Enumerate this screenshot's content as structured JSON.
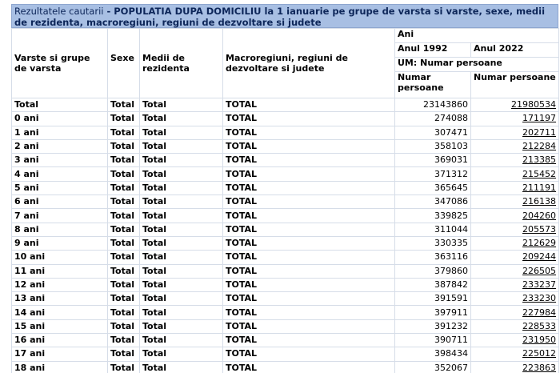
{
  "caption": {
    "lead": "Rezultatele cautarii",
    "rest": " - POPULATIA DUPA DOMICILIU la 1 ianuarie pe grupe de varsta si varste, sexe, medii de rezidenta, macroregiuni, regiuni de dezvoltare si judete"
  },
  "headers": {
    "age": "Varste si grupe de varsta",
    "sex": "Sexe",
    "medium": "Medii de rezidenta",
    "region": "Macroregiuni, regiuni de dezvoltare si judete",
    "ani": "Ani",
    "year1": "Anul 1992",
    "year2": "Anul 2022",
    "um": "UM: Numar persoane",
    "unit1": "Numar persoane",
    "unit2": "Numar persoane"
  },
  "rows": [
    {
      "age": "Total",
      "sex": "Total",
      "medium": "Total",
      "region": "TOTAL",
      "v1992": "23143860",
      "v2022": "21980534"
    },
    {
      "age": "0 ani",
      "sex": "Total",
      "medium": "Total",
      "region": "TOTAL",
      "v1992": "274088",
      "v2022": "171197"
    },
    {
      "age": "1 ani",
      "sex": "Total",
      "medium": "Total",
      "region": "TOTAL",
      "v1992": "307471",
      "v2022": "202711"
    },
    {
      "age": "2 ani",
      "sex": "Total",
      "medium": "Total",
      "region": "TOTAL",
      "v1992": "358103",
      "v2022": "212284"
    },
    {
      "age": "3 ani",
      "sex": "Total",
      "medium": "Total",
      "region": "TOTAL",
      "v1992": "369031",
      "v2022": "213385"
    },
    {
      "age": "4 ani",
      "sex": "Total",
      "medium": "Total",
      "region": "TOTAL",
      "v1992": "371312",
      "v2022": "215452"
    },
    {
      "age": "5 ani",
      "sex": "Total",
      "medium": "Total",
      "region": "TOTAL",
      "v1992": "365645",
      "v2022": "211191"
    },
    {
      "age": "6 ani",
      "sex": "Total",
      "medium": "Total",
      "region": "TOTAL",
      "v1992": "347086",
      "v2022": "216138"
    },
    {
      "age": "7 ani",
      "sex": "Total",
      "medium": "Total",
      "region": "TOTAL",
      "v1992": "339825",
      "v2022": "204260"
    },
    {
      "age": "8 ani",
      "sex": "Total",
      "medium": "Total",
      "region": "TOTAL",
      "v1992": "311044",
      "v2022": "205573"
    },
    {
      "age": "9 ani",
      "sex": "Total",
      "medium": "Total",
      "region": "TOTAL",
      "v1992": "330335",
      "v2022": "212629"
    },
    {
      "age": "10 ani",
      "sex": "Total",
      "medium": "Total",
      "region": "TOTAL",
      "v1992": "363116",
      "v2022": "209244"
    },
    {
      "age": "11 ani",
      "sex": "Total",
      "medium": "Total",
      "region": "TOTAL",
      "v1992": "379860",
      "v2022": "226505"
    },
    {
      "age": "12 ani",
      "sex": "Total",
      "medium": "Total",
      "region": "TOTAL",
      "v1992": "387842",
      "v2022": "233237"
    },
    {
      "age": "13 ani",
      "sex": "Total",
      "medium": "Total",
      "region": "TOTAL",
      "v1992": "391591",
      "v2022": "233230"
    },
    {
      "age": "14 ani",
      "sex": "Total",
      "medium": "Total",
      "region": "TOTAL",
      "v1992": "397911",
      "v2022": "227984"
    },
    {
      "age": "15 ani",
      "sex": "Total",
      "medium": "Total",
      "region": "TOTAL",
      "v1992": "391232",
      "v2022": "228533"
    },
    {
      "age": "16 ani",
      "sex": "Total",
      "medium": "Total",
      "region": "TOTAL",
      "v1992": "390711",
      "v2022": "231950"
    },
    {
      "age": "17 ani",
      "sex": "Total",
      "medium": "Total",
      "region": "TOTAL",
      "v1992": "398434",
      "v2022": "225012"
    },
    {
      "age": "18 ani",
      "sex": "Total",
      "medium": "Total",
      "region": "TOTAL",
      "v1992": "352067",
      "v2022": "223863"
    }
  ]
}
